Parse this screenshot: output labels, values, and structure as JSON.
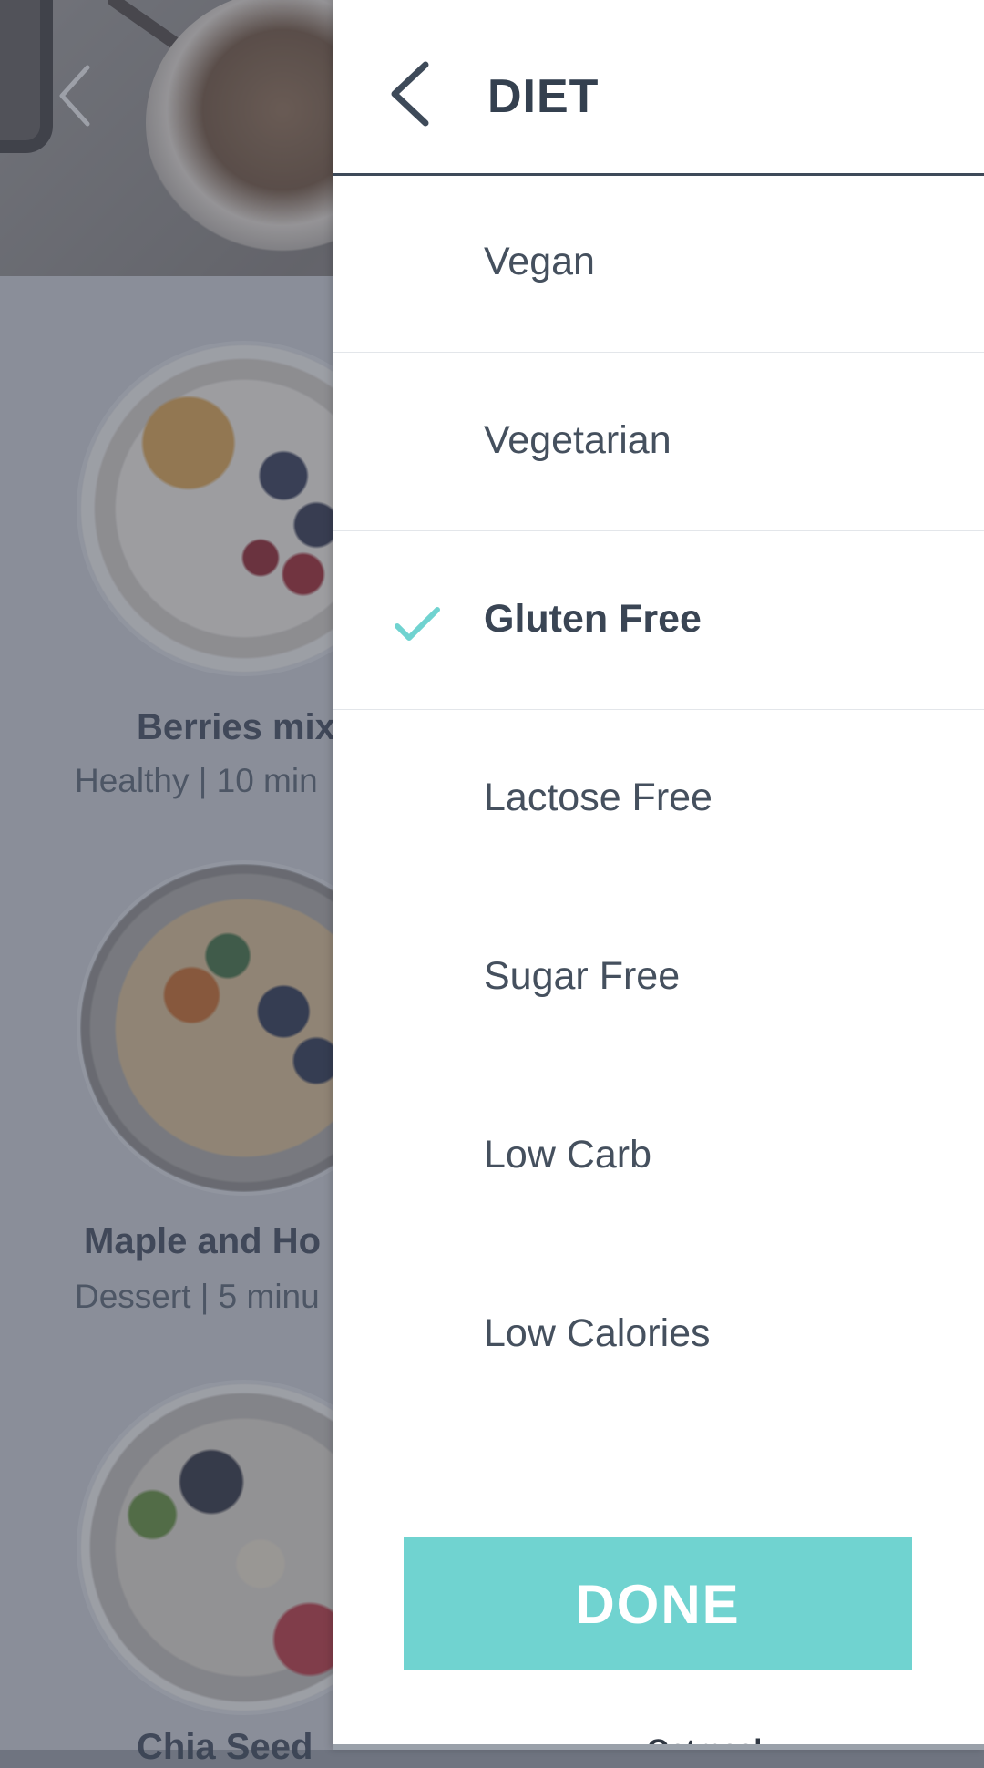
{
  "background": {
    "recipes": [
      {
        "title": "Berries mix",
        "meta": "Healthy | 10 min"
      },
      {
        "title": "Maple and Ho",
        "meta": "Dessert | 5 minu"
      },
      {
        "title": "Chia Seed"
      }
    ]
  },
  "drawer": {
    "title": "DIET",
    "options": [
      {
        "label": "Vegan",
        "selected": false
      },
      {
        "label": "Vegetarian",
        "selected": false
      },
      {
        "label": "Gluten Free",
        "selected": true
      },
      {
        "label": "Lactose Free",
        "selected": false
      },
      {
        "label": "Sugar Free",
        "selected": false
      },
      {
        "label": "Low Carb",
        "selected": false
      },
      {
        "label": "Low Calories",
        "selected": false
      }
    ],
    "done_label": "DONE",
    "peek_text": "Oatmeal"
  },
  "icons": {
    "back": "chevron-left-icon",
    "check": "check-icon"
  },
  "colors": {
    "accent": "#70d3d0",
    "text_dark": "#34404f",
    "overlay": "#464c5c"
  }
}
